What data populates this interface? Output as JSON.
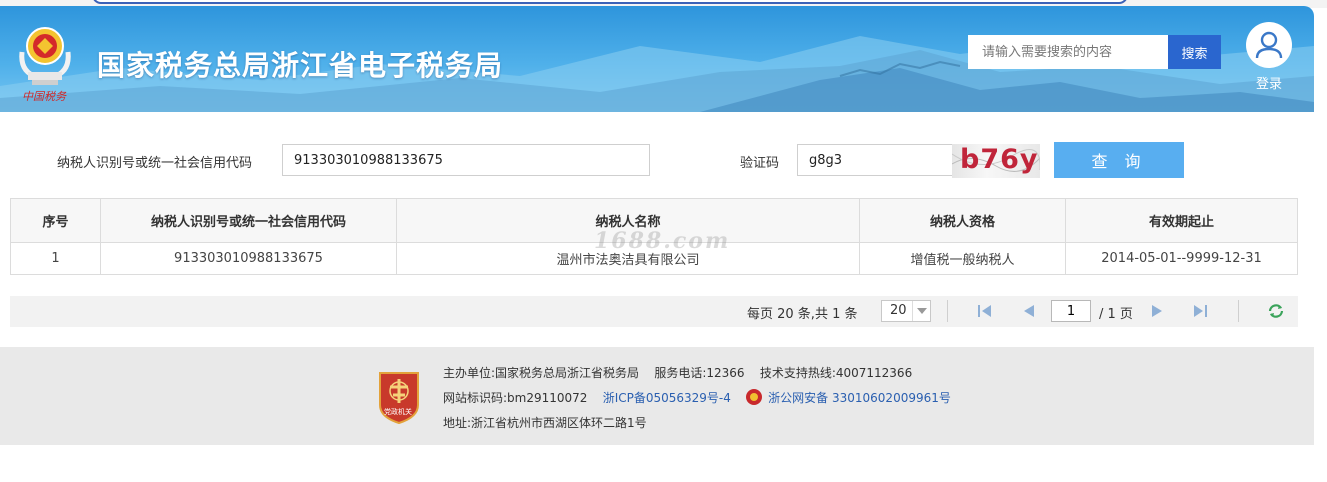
{
  "header": {
    "site_title": "国家税务总局浙江省电子税务局",
    "emblem_caption": "中国税务",
    "search_placeholder": "请输入需要搜索的内容",
    "search_button": "搜索",
    "login_label": "登录"
  },
  "form": {
    "taxpayer_id_label": "纳税人识别号或统一社会信用代码",
    "taxpayer_id_value": "913303010988133675",
    "captcha_label": "验证码",
    "captcha_value": "g8g3",
    "captcha_image_text": "b76y",
    "query_button": "查 询"
  },
  "table": {
    "headers": [
      "序号",
      "纳税人识别号或统一社会信用代码",
      "纳税人名称",
      "纳税人资格",
      "有效期起止"
    ],
    "rows": [
      [
        "1",
        "913303010988133675",
        "温州市法奥洁具有限公司",
        "增值税一般纳税人",
        "2014-05-01--9999-12-31"
      ]
    ]
  },
  "watermark": "1688.com",
  "pager": {
    "per_page_text": "每页 20 条,共 1 条",
    "page_size": "20",
    "current_page": "1",
    "total_pages_text": "/ 1 页"
  },
  "footer": {
    "host_label": "主办单位:",
    "host_value": "国家税务总局浙江省税务局",
    "service_phone": "服务电话:12366",
    "support_hotline": "技术支持热线:4007112366",
    "site_id": "网站标识码:bm29110072",
    "icp": "浙ICP备05056329号-4",
    "police_record": "浙公网安备 33010602009961号",
    "address": "地址:浙江省杭州市西湖区体环二路1号",
    "badge_text": "党政机关"
  },
  "colors": {
    "header_blue": "#2e95dc",
    "search_button": "#2a66cf",
    "query_button": "#58aef0",
    "captcha_text": "#c0253a",
    "link": "#2a5fb0",
    "refresh_green": "#3aa35a"
  }
}
